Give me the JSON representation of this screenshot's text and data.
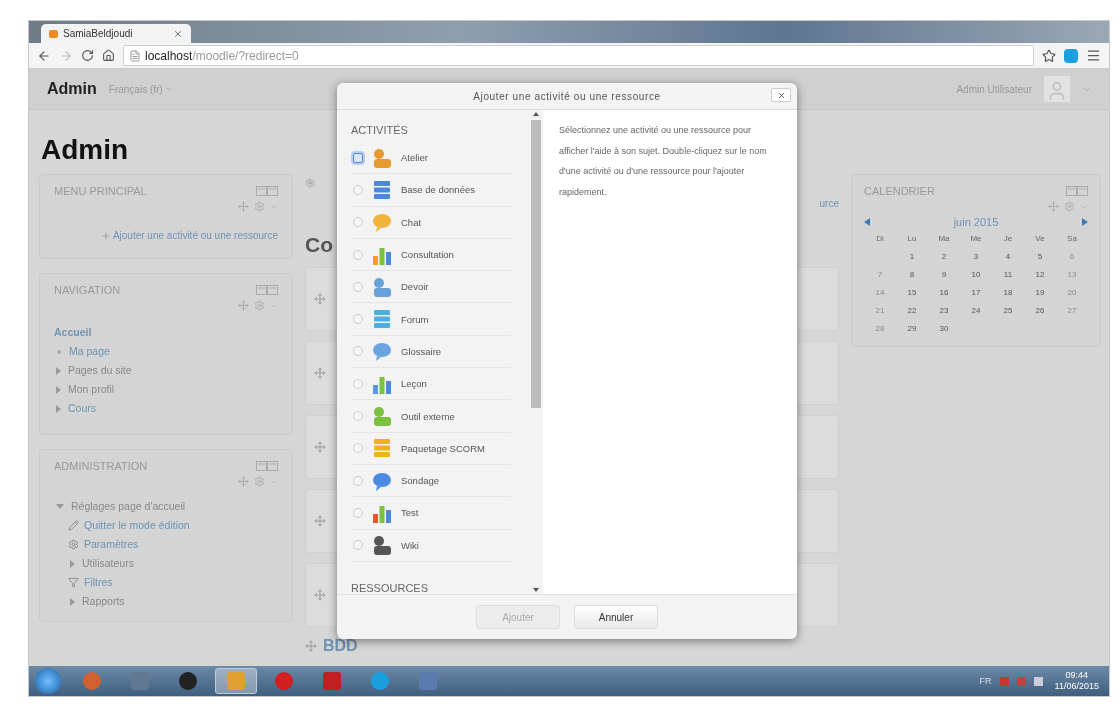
{
  "browser": {
    "tab_title": "SamiaBeldjoudi",
    "url_host": "localhost",
    "url_path": "/moodle/?redirect=0"
  },
  "navbar": {
    "brand": "Admin",
    "language": "Français (fr)",
    "user": "Admin Utilisateur"
  },
  "page_title": "Admin",
  "menu_principal": {
    "title": "MENU PRINCIPAL",
    "add_link": "Ajouter une activité ou une ressource"
  },
  "navigation": {
    "title": "NAVIGATION",
    "items": [
      {
        "label": "Accueil",
        "kind": "home",
        "link": true
      },
      {
        "label": "Ma page",
        "kind": "leaf",
        "link": true
      },
      {
        "label": "Pages du site",
        "kind": "branch",
        "link": false,
        "expanded": false
      },
      {
        "label": "Mon profil",
        "kind": "branch",
        "link": false,
        "expanded": false
      },
      {
        "label": "Cours",
        "kind": "branch",
        "link": true,
        "expanded": false
      }
    ]
  },
  "administration": {
    "title": "ADMINISTRATION",
    "items": [
      {
        "label": "Réglages page d'accueil",
        "kind": "branch",
        "link": false,
        "expanded": true,
        "children": [
          {
            "label": "Quitter le mode édition",
            "kind": "edit",
            "link": true
          },
          {
            "label": "Paramètres",
            "kind": "settings",
            "link": true
          },
          {
            "label": "Utilisateurs",
            "kind": "branch",
            "link": false,
            "expanded": false
          },
          {
            "label": "Filtres",
            "kind": "filter",
            "link": true
          },
          {
            "label": "Rapports",
            "kind": "branch",
            "link": false,
            "expanded": false
          }
        ]
      }
    ]
  },
  "content": {
    "heading": "Co",
    "link_fragment": "urce",
    "section_title": "BDD"
  },
  "calendar": {
    "title": "CALENDRIER",
    "month": "juin 2015",
    "weekdays": [
      "Di",
      "Lu",
      "Ma",
      "Me",
      "Je",
      "Ve",
      "Sa"
    ],
    "weeks": [
      [
        "1",
        "2",
        "3",
        "4",
        "5",
        "6"
      ],
      [
        "7",
        "8",
        "9",
        "10",
        "11",
        "12",
        "13"
      ],
      [
        "14",
        "15",
        "16",
        "17",
        "18",
        "19",
        "20"
      ],
      [
        "21",
        "22",
        "23",
        "24",
        "25",
        "26",
        "27"
      ],
      [
        "28",
        "29",
        "30"
      ]
    ]
  },
  "dialog": {
    "title": "Ajouter une activité ou une ressource",
    "sections": [
      {
        "heading": "ACTIVITÉS",
        "items": [
          {
            "label": "Atelier",
            "selected": false,
            "focused": true
          },
          {
            "label": "Base de données",
            "selected": false,
            "focused": false
          },
          {
            "label": "Chat",
            "selected": false,
            "focused": false
          },
          {
            "label": "Consultation",
            "selected": false,
            "focused": false
          },
          {
            "label": "Devoir",
            "selected": false,
            "focused": false
          },
          {
            "label": "Forum",
            "selected": false,
            "focused": false
          },
          {
            "label": "Glossaire",
            "selected": false,
            "focused": false
          },
          {
            "label": "Leçon",
            "selected": false,
            "focused": false
          },
          {
            "label": "Outil externe",
            "selected": false,
            "focused": false
          },
          {
            "label": "Paquetage SCORM",
            "selected": false,
            "focused": false
          },
          {
            "label": "Sondage",
            "selected": false,
            "focused": false
          },
          {
            "label": "Test",
            "selected": false,
            "focused": false
          },
          {
            "label": "Wiki",
            "selected": false,
            "focused": false
          }
        ]
      },
      {
        "heading": "RESSOURCES"
      }
    ],
    "help": "Sélectionnez une activité ou une ressource pour afficher l'aide à son sujet. Double-cliquez sur le nom d'une activité ou d'une ressource pour l'ajouter rapidement.",
    "buttons": [
      {
        "label": "Ajouter",
        "disabled": true
      },
      {
        "label": "Annuler",
        "disabled": false
      }
    ]
  },
  "taskbar": {
    "language": "FR",
    "time": "09:44",
    "date": "11/06/2015"
  }
}
